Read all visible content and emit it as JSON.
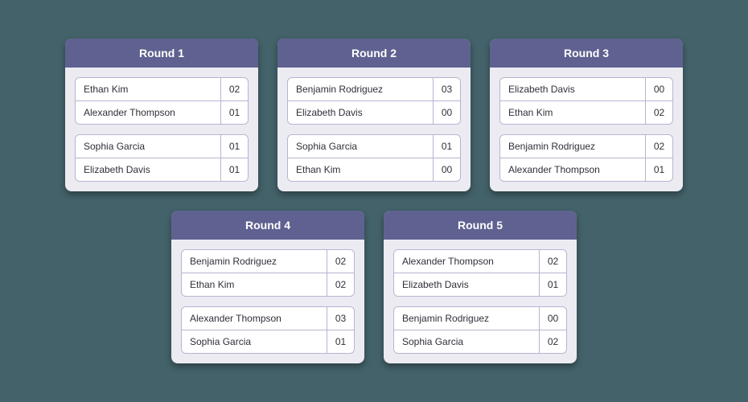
{
  "rounds": [
    {
      "title": "Round 1",
      "matches": [
        {
          "players": [
            {
              "name": "Ethan Kim",
              "score": "02"
            },
            {
              "name": "Alexander Thompson",
              "score": "01"
            }
          ]
        },
        {
          "players": [
            {
              "name": "Sophia Garcia",
              "score": "01"
            },
            {
              "name": "Elizabeth Davis",
              "score": "01"
            }
          ]
        }
      ]
    },
    {
      "title": "Round 2",
      "matches": [
        {
          "players": [
            {
              "name": "Benjamin Rodriguez",
              "score": "03"
            },
            {
              "name": "Elizabeth Davis",
              "score": "00"
            }
          ]
        },
        {
          "players": [
            {
              "name": "Sophia Garcia",
              "score": "01"
            },
            {
              "name": "Ethan Kim",
              "score": "00"
            }
          ]
        }
      ]
    },
    {
      "title": "Round 3",
      "matches": [
        {
          "players": [
            {
              "name": "Elizabeth Davis",
              "score": "00"
            },
            {
              "name": "Ethan Kim",
              "score": "02"
            }
          ]
        },
        {
          "players": [
            {
              "name": "Benjamin Rodriguez",
              "score": "02"
            },
            {
              "name": "Alexander Thompson",
              "score": "01"
            }
          ]
        }
      ]
    },
    {
      "title": "Round 4",
      "matches": [
        {
          "players": [
            {
              "name": "Benjamin Rodriguez",
              "score": "02"
            },
            {
              "name": "Ethan Kim",
              "score": "02"
            }
          ]
        },
        {
          "players": [
            {
              "name": "Alexander Thompson",
              "score": "03"
            },
            {
              "name": "Sophia Garcia",
              "score": "01"
            }
          ]
        }
      ]
    },
    {
      "title": "Round 5",
      "matches": [
        {
          "players": [
            {
              "name": "Alexander Thompson",
              "score": "02"
            },
            {
              "name": "Elizabeth Davis",
              "score": "01"
            }
          ]
        },
        {
          "players": [
            {
              "name": "Benjamin Rodriguez",
              "score": "00"
            },
            {
              "name": "Sophia Garcia",
              "score": "02"
            }
          ]
        }
      ]
    }
  ]
}
